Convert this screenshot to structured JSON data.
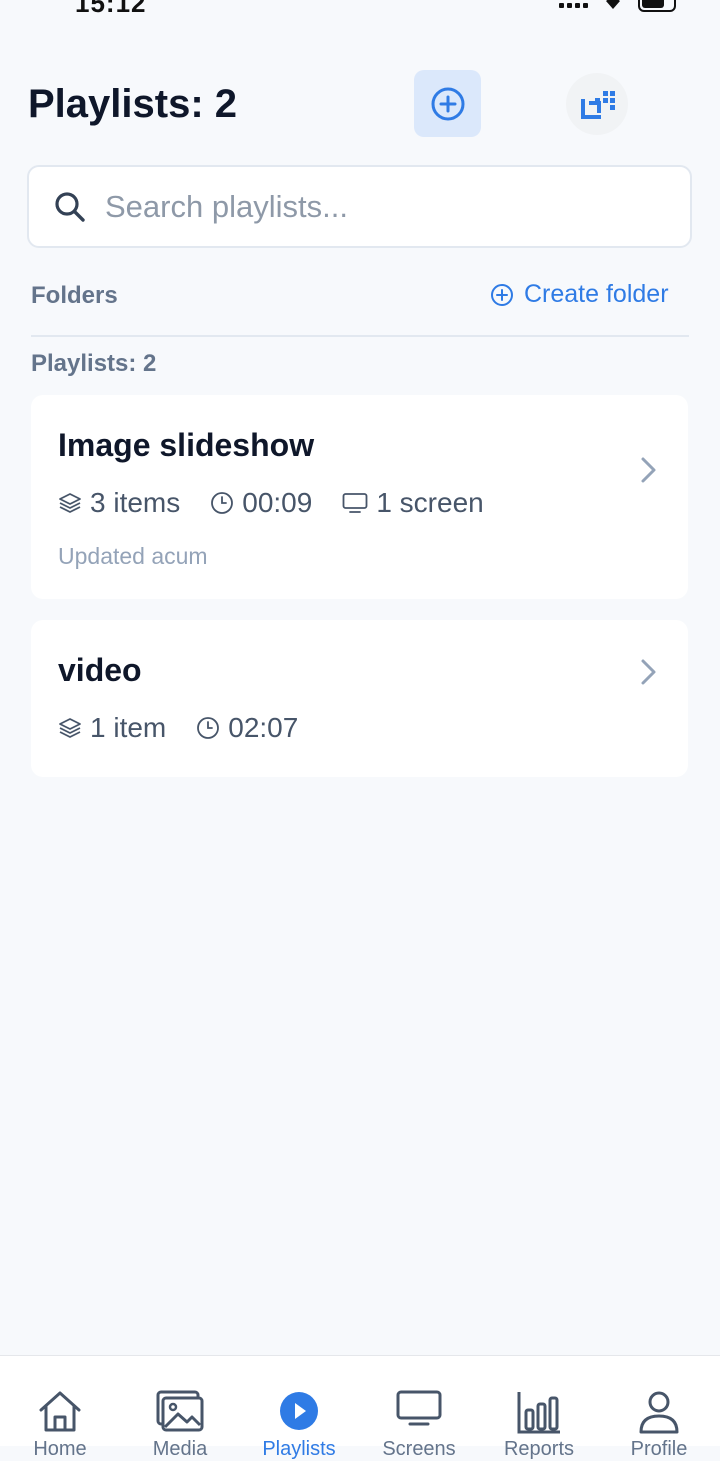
{
  "status": {
    "time": "15:12"
  },
  "header": {
    "title": "Playlists: 2"
  },
  "search": {
    "placeholder": "Search playlists..."
  },
  "folders": {
    "label": "Folders",
    "create_label": "Create folder"
  },
  "list": {
    "count_label": "Playlists: 2",
    "items": [
      {
        "title": "Image slideshow",
        "items": "3 items",
        "duration": "00:09",
        "screens": "1 screen",
        "updated": "Updated acum"
      },
      {
        "title": "video",
        "items": "1 item",
        "duration": "02:07"
      }
    ]
  },
  "nav": [
    {
      "label": "Home"
    },
    {
      "label": "Media"
    },
    {
      "label": "Playlists"
    },
    {
      "label": "Screens"
    },
    {
      "label": "Reports"
    },
    {
      "label": "Profile"
    }
  ],
  "colors": {
    "accent": "#2f7be5",
    "background": "#f7f9fc",
    "text": "#0f172a",
    "muted": "#64748b"
  }
}
